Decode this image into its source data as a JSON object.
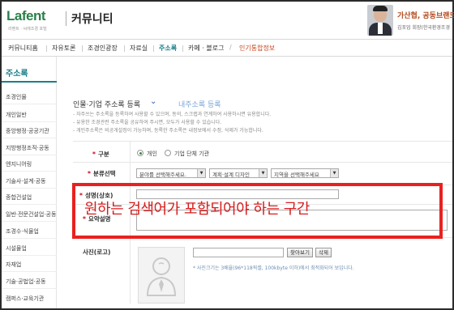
{
  "header": {
    "logo": "Lafent",
    "logo_sub": "라펜트 · 씨에조경 포털",
    "section_title": "커뮤니티",
    "promo_title": "가산협, 공동브랜드 도",
    "promo_sub": "김포업 회장(한국환경조경"
  },
  "nav": {
    "items": [
      "커뮤니티홈",
      "자유토론",
      "조경인광장",
      "자료실",
      "주소록",
      "카페 · 블로그",
      "인기통합정보"
    ],
    "active_index": 4,
    "hot_index": 6
  },
  "sidebar": {
    "title": "주소록",
    "items": [
      "조경인물",
      "개인일반",
      "중앙행정·공공기관",
      "지방행정조직·공동",
      "엔지니어링",
      "기술사·설계·공동",
      "종합건설업",
      "일반·전문건설업·공동",
      "조경수·식물업",
      "시설물업",
      "자재업",
      "기술·공법업·공동",
      "캠퍼스·교육기관"
    ]
  },
  "form": {
    "title": "인물·기업 주소록 등록",
    "tab2": "내주소록 등록",
    "notes": [
      "- 자주쓰는 주소록을 등록하여 사용할 수 있으며, 동의, 스크랩과 연계하여 사용하시면 유용합니다.",
      "- 유용한 조경관련 주소록을 공유하여 주시면, 모두가 사용할 수 있습니다.",
      "- 개인주소록은 비공개설정이 가능하며, 등록한 주소록은 내정보에서 수정, 삭제가 가능합니다."
    ],
    "type_label": "구분",
    "type_options": [
      "개인",
      "기업 단체 기관"
    ],
    "type_selected": 0,
    "category_label": "분류선택",
    "category_selects": [
      "분야를 선택해주세요.",
      "계획·설계 디자인",
      "지역을 선택해주세요"
    ],
    "name_label": "성명(상호)",
    "summary_label": "요약설명",
    "photo_label": "사진(로고)",
    "browse_button": "찾아보기",
    "delete_button": "삭제",
    "photo_note": "* 사진크기는 3배율(96*118픽셀, 100kbyte 이하)에서 최적화되어 보입니다."
  },
  "annotation": {
    "text": "원하는 검색어가 포함되어야 하는 구간",
    "color": "#e8211f"
  }
}
